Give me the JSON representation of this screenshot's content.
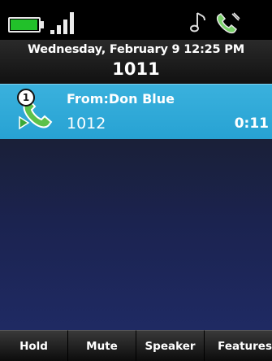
{
  "status_bar": {
    "icons": [
      "battery-icon",
      "signal-icon",
      "music-note-icon",
      "handset-icon"
    ],
    "colors": {
      "battery": "#22c02a",
      "handset": "#7ad16a"
    }
  },
  "header": {
    "date_time": "Wednesday, February 9 12:25 PM",
    "line_number": "1011"
  },
  "call": {
    "badge": "1",
    "from_label": "From:Don Blue",
    "number": "1012",
    "timer": "0:11",
    "icon": "active-call-icon",
    "colors": {
      "row": "#2fa8d8"
    }
  },
  "softkeys": [
    {
      "label": "Hold"
    },
    {
      "label": "Mute"
    },
    {
      "label": "Speaker"
    },
    {
      "label": "Features"
    }
  ]
}
